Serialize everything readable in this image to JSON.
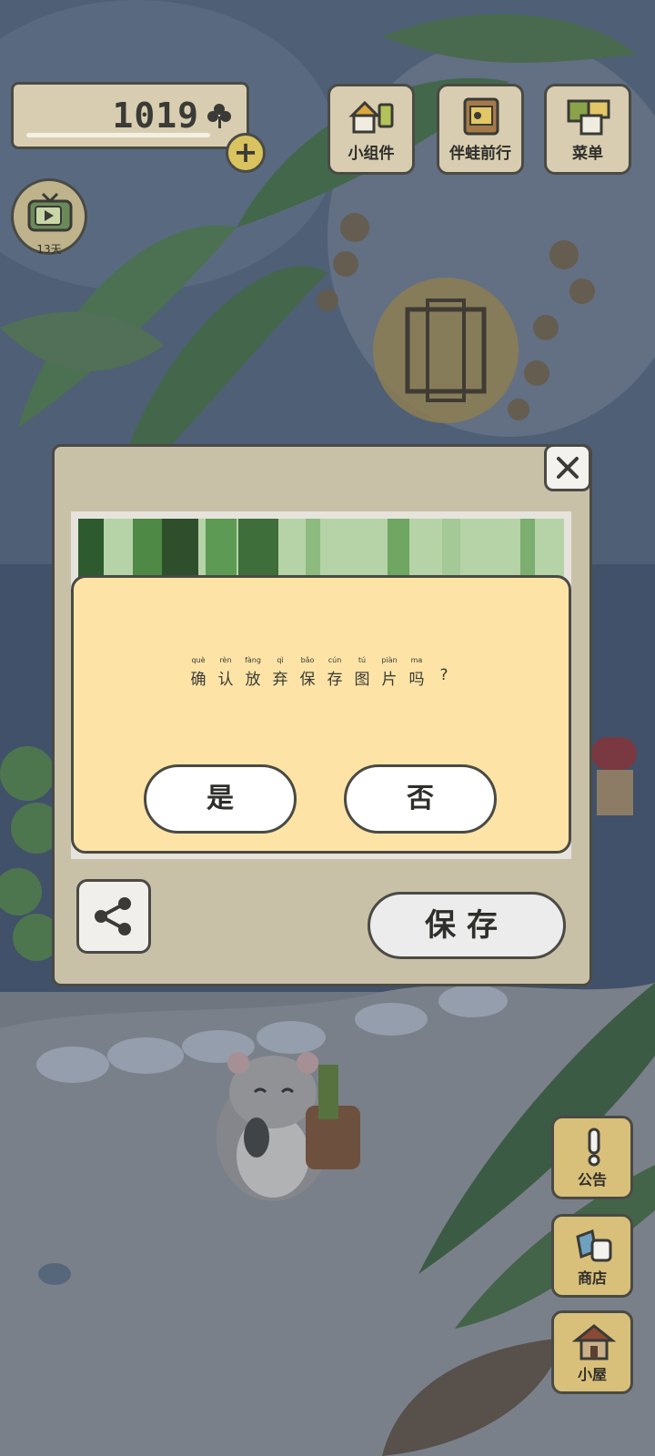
{
  "hud": {
    "coins": "1019",
    "tv_days": "13天",
    "buttons": [
      {
        "label": "小组件",
        "icon": "widget-icon"
      },
      {
        "label": "伴蛙前行",
        "icon": "photo-album-icon"
      },
      {
        "label": "菜单",
        "icon": "menu-icon"
      }
    ]
  },
  "dialog": {
    "message": [
      {
        "py": "què",
        "hz": "确"
      },
      {
        "py": "rèn",
        "hz": "认"
      },
      {
        "py": "fàng",
        "hz": "放"
      },
      {
        "py": "qì",
        "hz": "弃"
      },
      {
        "py": "bǎo",
        "hz": "保"
      },
      {
        "py": "cún",
        "hz": "存"
      },
      {
        "py": "tú",
        "hz": "图"
      },
      {
        "py": "piàn",
        "hz": "片"
      },
      {
        "py": "ma",
        "hz": "吗"
      },
      {
        "py": "",
        "hz": "?"
      }
    ],
    "yes_label": "是",
    "no_label": "否",
    "save_label": "保存"
  },
  "side": {
    "notice_label": "公告",
    "shop_label": "商店",
    "house_label": "小屋"
  },
  "colors": {
    "panel": "#c9c0a8",
    "confirm_bg": "#fde4a6",
    "outline": "#4a4a45",
    "button_wood": "#d9c07a"
  }
}
